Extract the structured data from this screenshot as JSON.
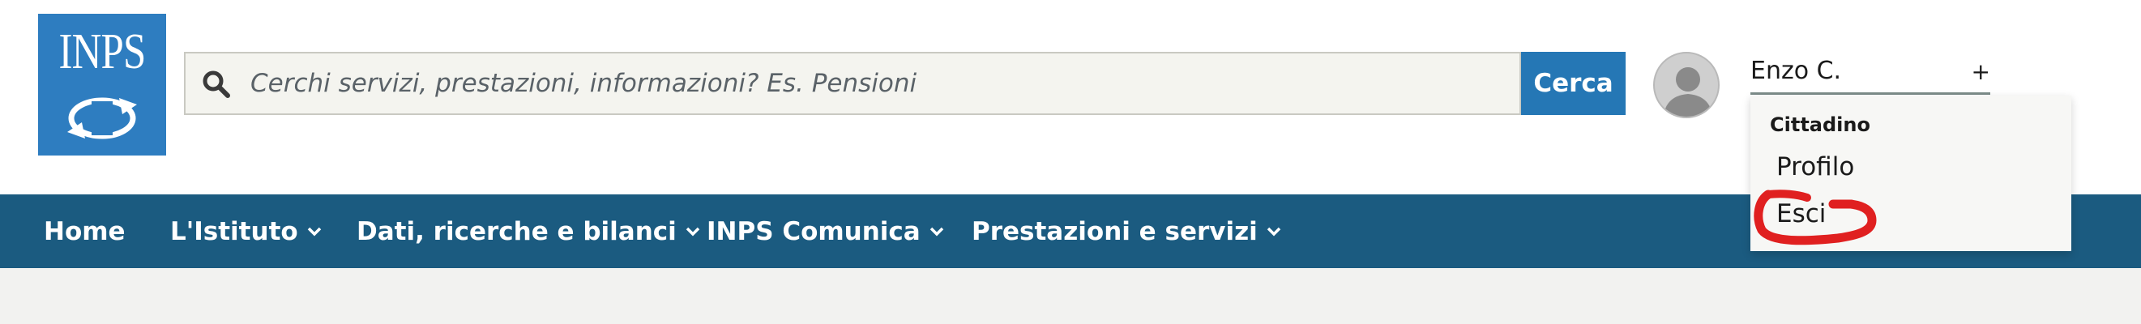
{
  "brand": {
    "logo_text": "INPS",
    "primary_color": "#2e7dc0",
    "nav_color": "#1b5b80"
  },
  "search": {
    "placeholder": "Cerchi servizi, prestazioni, informazioni? Es. Pensioni",
    "value": "",
    "button_label": "Cerca",
    "icon": "search-icon"
  },
  "user": {
    "name": "Enzo C.",
    "toggle_symbol": "+",
    "avatar_icon": "user-silhouette-icon"
  },
  "user_menu": {
    "category": "Cittadino",
    "items": [
      {
        "label": "Profilo"
      },
      {
        "label": "Esci",
        "highlighted": true,
        "highlight_color": "#e02020"
      }
    ]
  },
  "nav": {
    "items": [
      {
        "label": "Home",
        "has_dropdown": false
      },
      {
        "label": "L'Istituto",
        "has_dropdown": true
      },
      {
        "label": "Dati, ricerche e bilanci",
        "has_dropdown": true
      },
      {
        "label": "INPS Comunica",
        "has_dropdown": true
      },
      {
        "label": "Prestazioni e servizi",
        "has_dropdown": true
      }
    ]
  }
}
